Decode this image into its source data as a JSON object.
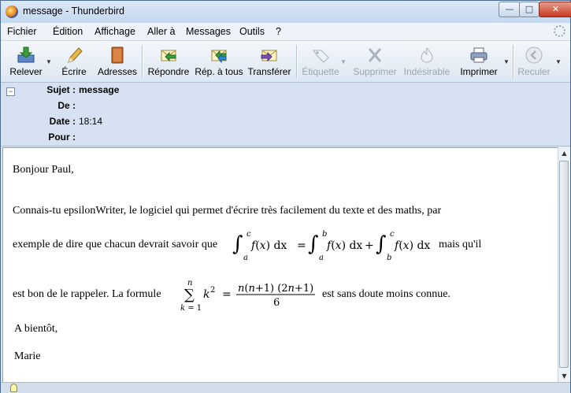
{
  "window": {
    "title": "message - Thunderbird"
  },
  "menu": [
    {
      "label": "Fichier"
    },
    {
      "label": "Édition"
    },
    {
      "label": "Affichage"
    },
    {
      "label": "Aller à"
    },
    {
      "label": "Messages"
    },
    {
      "label": "Outils"
    },
    {
      "label": "?"
    }
  ],
  "toolbar": {
    "relever": "Relever",
    "ecrire": "Écrire",
    "adresses": "Adresses",
    "repondre": "Répondre",
    "rep_tous": "Rép. à tous",
    "transferer": "Transférer",
    "etiquette": "Étiquette",
    "supprimer": "Supprimer",
    "indesirable": "Indésirable",
    "imprimer": "Imprimer",
    "reculer": "Reculer"
  },
  "header": {
    "subject_label": "Sujet :",
    "subject_value": "message",
    "from_label": "De :",
    "date_label": "Date :",
    "date_value": "18:14",
    "to_label": "Pour :"
  },
  "body": {
    "greeting": "Bonjour Paul,",
    "line1": "Connais-tu epsilonWriter, le logiciel qui permet d'écrire très facilement du texte et des maths, par",
    "line2_start": "exemple de dire que chacun devrait savoir que",
    "line2_end": "mais qu'il",
    "line3_start": "est bon de le rappeler. La formule",
    "line3_end": "est sans doute moins connue.",
    "closing": "A bientôt,",
    "signature": "Marie"
  },
  "colors": {
    "accent": "#c63a22",
    "panel": "#d6e2f1"
  }
}
